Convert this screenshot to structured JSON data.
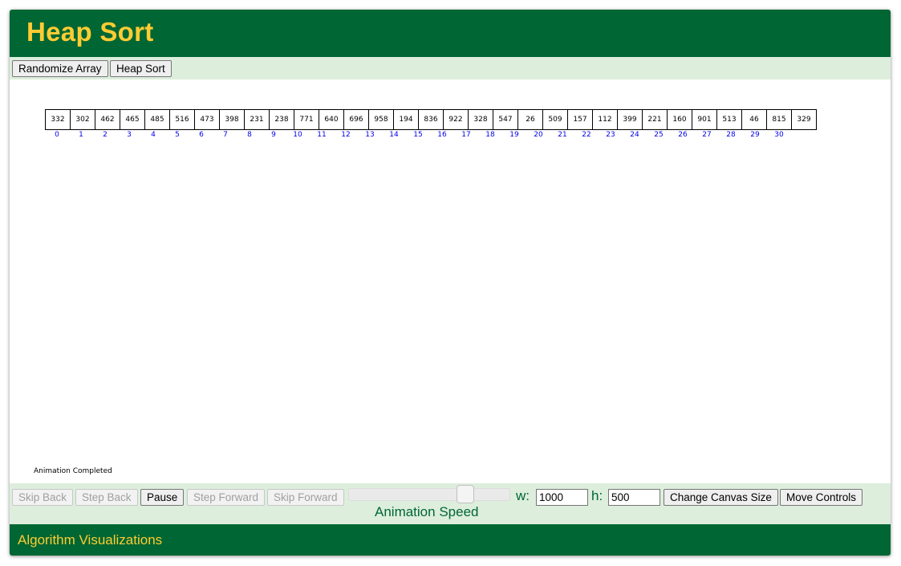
{
  "header": {
    "title": "Heap Sort"
  },
  "algorithm_controls": {
    "randomize_label": "Randomize Array",
    "heap_sort_label": "Heap Sort"
  },
  "array": {
    "values": [
      "332",
      "302",
      "462",
      "465",
      "485",
      "516",
      "473",
      "398",
      "231",
      "238",
      "771",
      "640",
      "696",
      "958",
      "194",
      "836",
      "922",
      "328",
      "547",
      "26",
      "509",
      "157",
      "112",
      "399",
      "221",
      "160",
      "901",
      "513",
      "46",
      "815",
      "329"
    ],
    "indices": [
      "0",
      "1",
      "2",
      "3",
      "4",
      "5",
      "6",
      "7",
      "8",
      "9",
      "10",
      "11",
      "12",
      "13",
      "14",
      "15",
      "16",
      "17",
      "18",
      "19",
      "20",
      "21",
      "22",
      "23",
      "24",
      "25",
      "26",
      "27",
      "28",
      "29",
      "30"
    ]
  },
  "status": {
    "message": "Animation Completed"
  },
  "animation_controls": {
    "skip_back_label": "Skip Back",
    "step_back_label": "Step Back",
    "pause_label": "Pause",
    "step_forward_label": "Step Forward",
    "skip_forward_label": "Skip Forward",
    "speed_label": "Animation Speed",
    "speed_level": 0.75,
    "width_label": "w:",
    "width_value": "1000",
    "height_label": "h:",
    "height_value": "500",
    "change_size_label": "Change Canvas Size",
    "move_controls_label": "Move Controls"
  },
  "footer": {
    "text": "Algorithm Visualizations"
  },
  "colors": {
    "brand_green": "#006633",
    "brand_gold": "#ffcc33",
    "panel_green": "#ddeedd",
    "index_blue": "#0000ee"
  }
}
